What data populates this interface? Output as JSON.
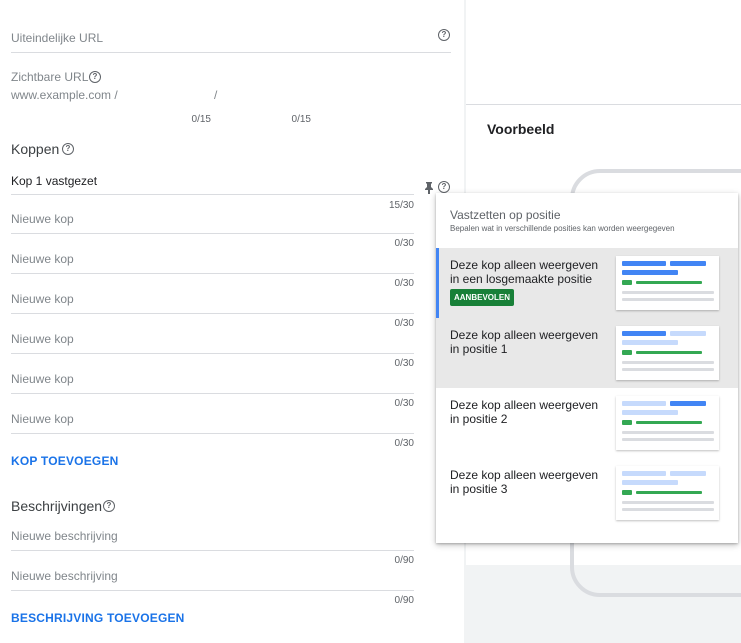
{
  "form": {
    "final_url_placeholder": "Uiteindelijke URL",
    "display_url_label": "Zichtbare URL",
    "display_url_base": "www.example.com /",
    "display_url_sep": "/",
    "path1_count": "0/15",
    "path2_count": "0/15",
    "headlines_title": "Koppen",
    "headline1_value": "Kop 1 vastgezet",
    "headline1_count": "15/30",
    "headline_placeholder": "Nieuwe kop",
    "headlines": [
      {
        "placeholder": "Nieuwe kop",
        "count": "0/30"
      },
      {
        "placeholder": "Nieuwe kop",
        "count": "0/30"
      },
      {
        "placeholder": "Nieuwe kop",
        "count": "0/30"
      },
      {
        "placeholder": "Nieuwe kop",
        "count": "0/30"
      },
      {
        "placeholder": "Nieuwe kop",
        "count": "0/30"
      },
      {
        "placeholder": "Nieuwe kop",
        "count": "0/30"
      }
    ],
    "add_headline": "KOP TOEVOEGEN",
    "descriptions_title": "Beschrijvingen",
    "descriptions": [
      {
        "placeholder": "Nieuwe beschrijving",
        "count": "0/90"
      },
      {
        "placeholder": "Nieuwe beschrijving",
        "count": "0/90"
      }
    ],
    "add_description": "BESCHRIJVING TOEVOEGEN"
  },
  "preview": {
    "title": "Voorbeeld"
  },
  "pin_menu": {
    "title": "Vastzetten op positie",
    "subtitle": "Bepalen wat in verschillende posities kan worden weergegeven",
    "options": [
      {
        "label": "Deze kop alleen weergeven in een losgemaakte positie",
        "badge": "AANBEVOLEN",
        "selected": true
      },
      {
        "label": "Deze kop alleen weergeven in positie 1",
        "selected": false
      },
      {
        "label": "Deze kop alleen weergeven in positie 2",
        "selected": false
      },
      {
        "label": "Deze kop alleen weergeven in positie 3",
        "selected": false
      }
    ]
  },
  "colors": {
    "accent": "#1a73e8",
    "badge": "#188038",
    "highlight_bar": "#4285f4",
    "thumb_green": "#34a853",
    "thumb_light_blue": "#c6dafc"
  },
  "icons": [
    "help-icon",
    "pin-icon"
  ]
}
